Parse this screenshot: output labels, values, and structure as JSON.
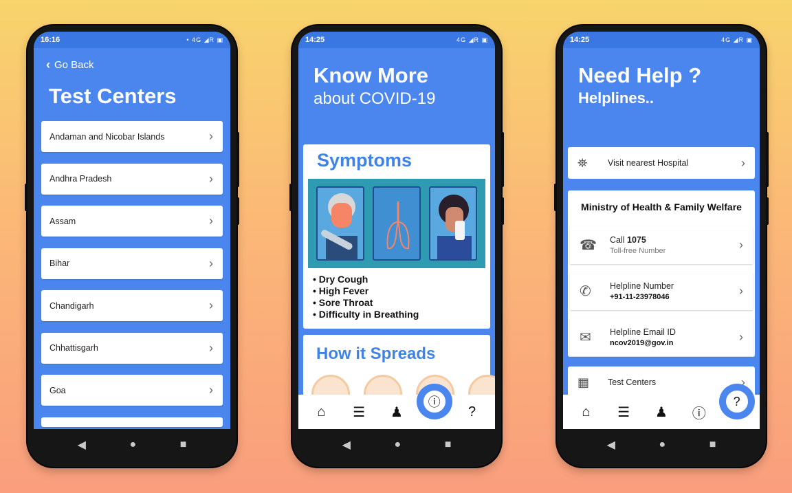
{
  "phone1": {
    "status_time": "16:16",
    "status_icons": "• 4G ◢R ▣",
    "go_back": "Go Back",
    "title": "Test Centers",
    "states": [
      "Andaman and Nicobar Islands",
      "Andhra Pradesh",
      "Assam",
      "Bihar",
      "Chandigarh",
      "Chhattisgarh",
      "Goa"
    ]
  },
  "phone2": {
    "status_time": "14:25",
    "status_icons": "4G ◢R ▣",
    "hero_title": "Know More",
    "hero_sub": "about COVID-19",
    "symptoms_title": "Symptoms",
    "symptoms": [
      "• Dry Cough",
      "• High Fever",
      "• Sore Throat",
      "• Difficulty in Breathing"
    ],
    "spread_title": "How it Spreads"
  },
  "phone3": {
    "status_time": "14:25",
    "status_icons": "4G ◢R ▣",
    "hero_title": "Need Help ?",
    "hero_sub": "Helplines..",
    "visit_hospital": "Visit nearest Hospital",
    "ministry_title": "Ministry of Health & Family Welfare",
    "call_label": "Call",
    "call_number": "1075",
    "call_sub": "Toll-free Number",
    "helpline_label": "Helpline Number",
    "helpline_number": "+91-11-23978046",
    "email_label": "Helpline Email ID",
    "email_value": "ncov2019@gov.in",
    "test_centers": "Test Centers"
  },
  "colors": {
    "accent": "#4a86ee",
    "status": "#3a77e2",
    "heading": "#3f83e5"
  }
}
